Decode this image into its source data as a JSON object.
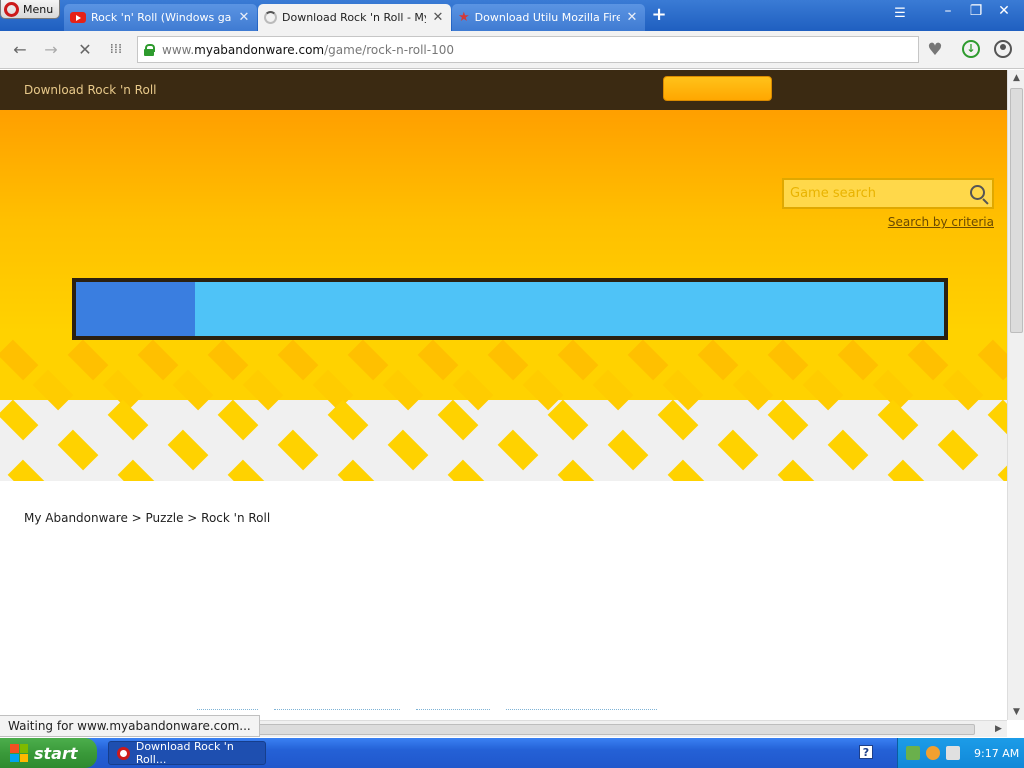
{
  "browser": {
    "menu_label": "Menu",
    "tabs": [
      {
        "title": "Rock 'n' Roll (Windows game",
        "icon": "youtube-icon",
        "active": false
      },
      {
        "title": "Download Rock 'n Roll - My Al",
        "icon": "loading-spinner-icon",
        "active": true
      },
      {
        "title": "Download Utilu Mozilla Firefo",
        "icon": "star-icon",
        "active": false
      }
    ],
    "new_tab_label": "+",
    "url_prefix": "www.",
    "url_domain": "myabandonware.com",
    "url_path": "/game/rock-n-roll-100",
    "status_text": "Waiting for www.myabandonware.com..."
  },
  "site": {
    "header_title": "Download Rock 'n Roll",
    "search_placeholder": "Game search",
    "search_criteria_link": "Search by criteria",
    "progress_fraction": 0.137,
    "breadcrumb": "My Abandonware > Puzzle > Rock 'n Roll"
  },
  "taskbar": {
    "start_label": "start",
    "task_item": "Download Rock 'n Roll...",
    "clock": "9:17 AM"
  },
  "colors": {
    "accent_yellow": "#ffd200",
    "header_brown": "#3b2a12",
    "progress_track": "#4fc3f7",
    "progress_fill": "#3a7ee0"
  }
}
